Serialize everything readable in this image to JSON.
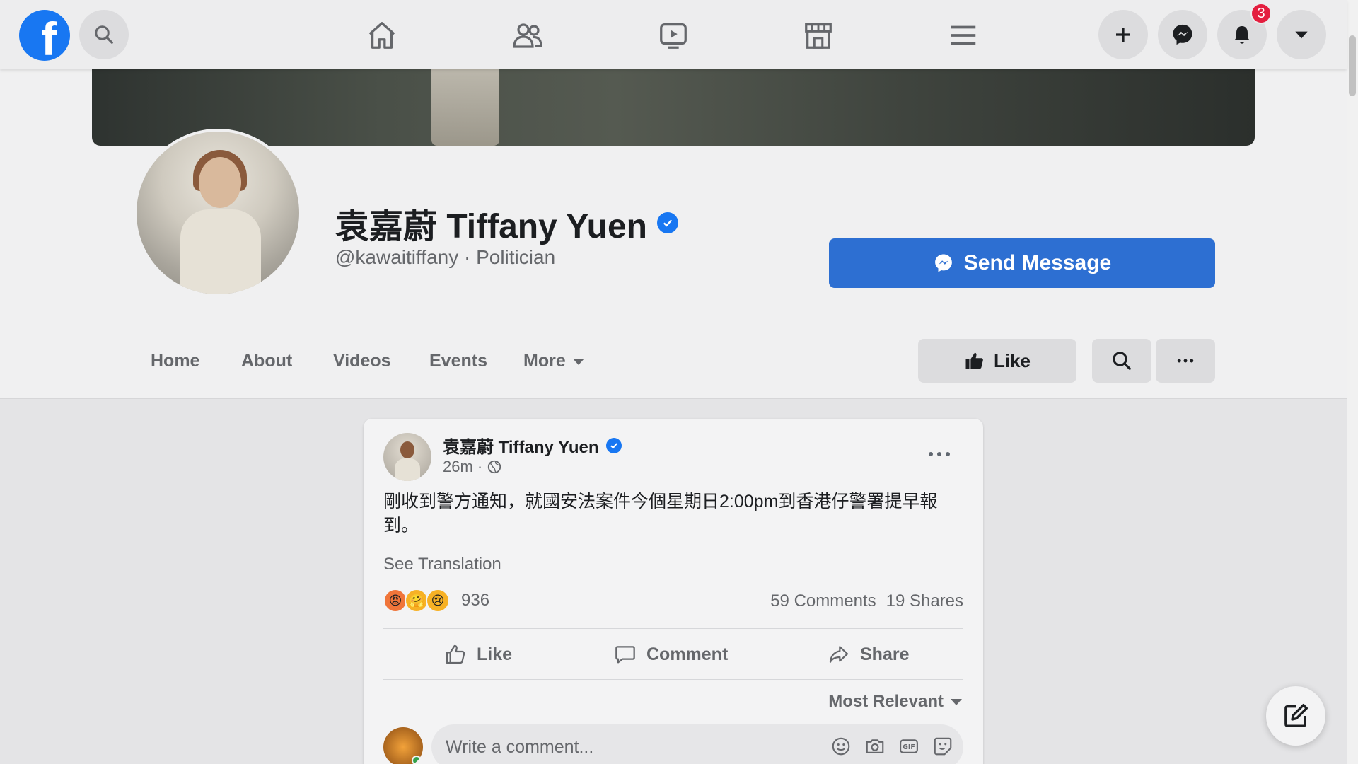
{
  "nav": {
    "logo_letter": "f",
    "badge_count": "3"
  },
  "profile": {
    "name": "袁嘉蔚 Tiffany Yuen",
    "handle": "@kawaitiffany · Politician",
    "send_message_label": "Send Message",
    "tabs": [
      "Home",
      "About",
      "Videos",
      "Events",
      "More"
    ],
    "like_label": "Like"
  },
  "post": {
    "author": "袁嘉蔚 Tiffany Yuen",
    "time": "26m ·",
    "text": "剛收到警方通知，就國安法案件今個星期日2:00pm到香港仔警署提早報到。",
    "see_translation": "See Translation",
    "reaction_count": "936",
    "comments": "59 Comments",
    "shares": "19 Shares",
    "actions": [
      "Like",
      "Comment",
      "Share"
    ],
    "sort_label": "Most Relevant",
    "comment_placeholder": "Write a comment..."
  },
  "colors": {
    "brand": "#1877f2",
    "send_button": "#2d6fd2",
    "badge": "#e41e3f"
  }
}
